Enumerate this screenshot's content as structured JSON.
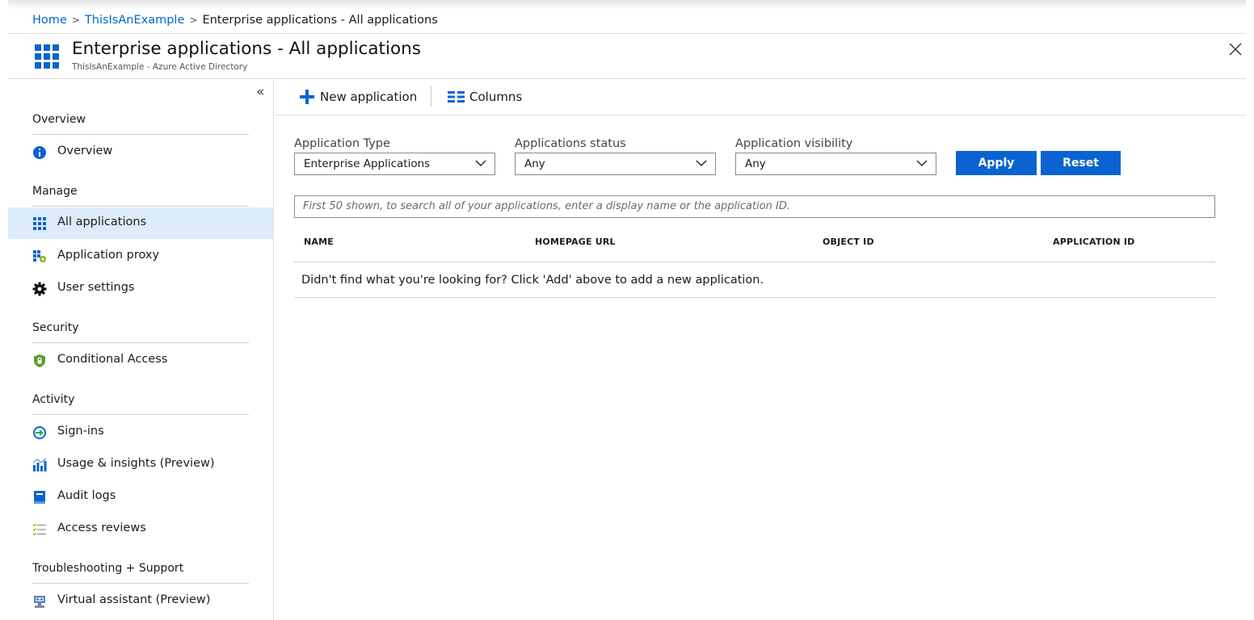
{
  "breadcrumb": {
    "home": "Home",
    "tenant": "ThisIsAnExample",
    "current": "Enterprise applications - All applications"
  },
  "header": {
    "title": "Enterprise applications - All applications",
    "subtitle": "ThisIsAnExample - Azure Active Directory"
  },
  "sidebar": {
    "collapse_label": "«",
    "sections": {
      "overview": "Overview",
      "manage": "Manage",
      "security": "Security",
      "activity": "Activity",
      "troubleshooting": "Troubleshooting + Support"
    },
    "items": [
      {
        "label": "Overview",
        "icon": "info-icon"
      },
      {
        "label": "All applications",
        "icon": "grid-icon",
        "active": true
      },
      {
        "label": "Application proxy",
        "icon": "proxy-icon"
      },
      {
        "label": "User settings",
        "icon": "gear-icon"
      },
      {
        "label": "Conditional Access",
        "icon": "shield-icon"
      },
      {
        "label": "Sign-ins",
        "icon": "sign-in-icon"
      },
      {
        "label": "Usage & insights (Preview)",
        "icon": "chart-icon"
      },
      {
        "label": "Audit logs",
        "icon": "book-icon"
      },
      {
        "label": "Access reviews",
        "icon": "checklist-icon"
      },
      {
        "label": "Virtual assistant (Preview)",
        "icon": "bot-icon"
      }
    ]
  },
  "toolbar": {
    "new_application": "New application",
    "columns": "Columns"
  },
  "filters": {
    "application_type": {
      "label": "Application Type",
      "value": "Enterprise Applications"
    },
    "status": {
      "label": "Applications status",
      "value": "Any"
    },
    "visibility": {
      "label": "Application visibility",
      "value": "Any"
    },
    "apply": "Apply",
    "reset": "Reset"
  },
  "search": {
    "placeholder": "First 50 shown, to search all of your applications, enter a display name or the application ID."
  },
  "table": {
    "columns": [
      "NAME",
      "HOMEPAGE URL",
      "OBJECT ID",
      "APPLICATION ID"
    ],
    "empty_message": "Didn't find what you're looking for? Click 'Add' above to add a new application."
  },
  "colors": {
    "accent": "#0b63d1",
    "link": "#0066cc",
    "active_nav": "#ddecfa"
  }
}
